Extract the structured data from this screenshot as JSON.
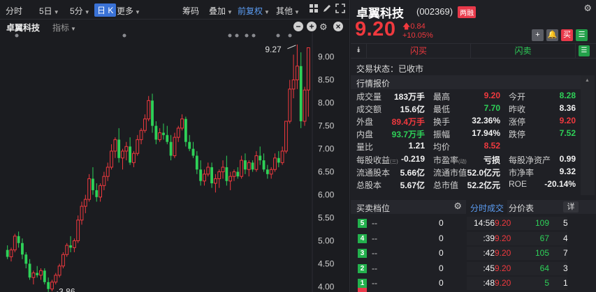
{
  "toolbar": {
    "items": [
      "分时",
      "5日",
      "5分",
      "日 K",
      "更多",
      "筹码",
      "叠加",
      "前复权",
      "其他"
    ]
  },
  "chart_header": {
    "stock_name": "卓翼科技",
    "indicator_label": "指标"
  },
  "chart_data": {
    "type": "candlestick",
    "y_ticks": [
      "9.00",
      "8.50",
      "8.00",
      "7.50",
      "7.00",
      "6.50",
      "6.00",
      "5.50",
      "5.00",
      "4.50",
      "4.00"
    ],
    "ylim": [
      3.9,
      9.45
    ],
    "annotations": {
      "high_label": "9.27",
      "low_label": "3.86"
    },
    "candles": [
      [
        4.8,
        4.9,
        4.6,
        4.65
      ],
      [
        4.65,
        4.85,
        4.55,
        4.8
      ],
      [
        4.8,
        5.15,
        4.75,
        5.1
      ],
      [
        5.1,
        5.2,
        4.85,
        4.95
      ],
      [
        4.95,
        5.05,
        4.6,
        4.7
      ],
      [
        4.7,
        4.75,
        4.4,
        4.5
      ],
      [
        4.5,
        4.6,
        4.15,
        4.2
      ],
      [
        4.2,
        4.35,
        4.05,
        4.3
      ],
      [
        4.3,
        4.45,
        4.2,
        4.25
      ],
      [
        4.25,
        4.4,
        4.15,
        4.35
      ],
      [
        4.35,
        4.4,
        4.05,
        4.1
      ],
      [
        4.1,
        4.2,
        3.86,
        3.95
      ],
      [
        3.95,
        4.15,
        3.9,
        4.1
      ],
      [
        4.1,
        4.3,
        4.05,
        4.25
      ],
      [
        4.25,
        4.5,
        4.2,
        4.45
      ],
      [
        4.45,
        4.75,
        4.4,
        4.7
      ],
      [
        4.7,
        4.95,
        4.65,
        4.9
      ],
      [
        4.9,
        5.1,
        4.75,
        4.85
      ],
      [
        4.85,
        5.05,
        4.75,
        5.0
      ],
      [
        5.0,
        5.55,
        4.95,
        5.45
      ],
      [
        5.45,
        5.85,
        5.35,
        5.75
      ],
      [
        5.75,
        6.0,
        5.6,
        5.9
      ],
      [
        5.9,
        6.45,
        5.85,
        6.35
      ],
      [
        6.35,
        6.6,
        6.0,
        6.1
      ],
      [
        6.1,
        6.25,
        5.85,
        5.95
      ],
      [
        5.95,
        6.25,
        5.85,
        6.2
      ],
      [
        6.2,
        6.5,
        6.1,
        6.4
      ],
      [
        6.4,
        6.7,
        6.3,
        6.6
      ],
      [
        6.6,
        7.1,
        6.55,
        6.95
      ],
      [
        6.95,
        7.25,
        6.8,
        7.2
      ],
      [
        7.2,
        7.45,
        6.7,
        6.8
      ],
      [
        6.8,
        7.0,
        6.55,
        6.95
      ],
      [
        6.95,
        7.15,
        6.75,
        7.05
      ],
      [
        7.05,
        7.25,
        6.65,
        6.7
      ],
      [
        6.7,
        6.95,
        6.6,
        6.9
      ],
      [
        6.9,
        7.3,
        6.85,
        7.2
      ],
      [
        7.2,
        7.45,
        7.1,
        7.4
      ],
      [
        7.4,
        7.75,
        7.35,
        7.65
      ],
      [
        7.65,
        8.15,
        7.6,
        8.05
      ],
      [
        8.05,
        8.2,
        7.35,
        7.5
      ],
      [
        7.5,
        7.6,
        7.1,
        7.2
      ],
      [
        7.2,
        7.45,
        7.15,
        7.35
      ],
      [
        7.35,
        7.55,
        7.2,
        7.3
      ],
      [
        7.3,
        7.5,
        7.1,
        7.15
      ],
      [
        7.15,
        7.3,
        6.75,
        6.85
      ],
      [
        6.85,
        7.35,
        6.8,
        7.25
      ],
      [
        7.25,
        7.5,
        7.15,
        7.45
      ],
      [
        7.45,
        7.75,
        7.4,
        7.65
      ],
      [
        7.65,
        7.7,
        7.05,
        7.15
      ],
      [
        7.15,
        7.3,
        6.95,
        7.0
      ],
      [
        7.0,
        7.15,
        6.8,
        6.85
      ],
      [
        6.85,
        6.95,
        6.45,
        6.55
      ],
      [
        6.55,
        6.75,
        6.2,
        6.3
      ],
      [
        6.3,
        6.55,
        6.2,
        6.45
      ],
      [
        6.45,
        6.7,
        6.4,
        6.6
      ],
      [
        6.6,
        6.7,
        6.15,
        6.25
      ],
      [
        6.25,
        6.45,
        6.05,
        6.35
      ],
      [
        6.35,
        6.55,
        6.15,
        6.5
      ],
      [
        6.5,
        6.75,
        6.35,
        6.6
      ],
      [
        6.6,
        6.85,
        6.2,
        6.3
      ],
      [
        6.3,
        6.5,
        6.1,
        6.4
      ],
      [
        6.4,
        6.55,
        6.3,
        6.5
      ],
      [
        6.5,
        6.6,
        6.35,
        6.4
      ],
      [
        6.4,
        6.85,
        6.35,
        6.75
      ],
      [
        6.75,
        6.9,
        6.45,
        6.55
      ],
      [
        6.55,
        6.75,
        6.4,
        6.7
      ],
      [
        6.7,
        6.75,
        6.5,
        6.55
      ],
      [
        6.55,
        6.95,
        6.5,
        6.85
      ],
      [
        6.85,
        7.05,
        6.65,
        6.75
      ],
      [
        6.75,
        6.9,
        6.5,
        6.55
      ],
      [
        6.55,
        6.65,
        6.35,
        6.45
      ],
      [
        6.45,
        6.6,
        6.35,
        6.55
      ],
      [
        6.55,
        6.9,
        6.5,
        6.8
      ],
      [
        6.8,
        6.95,
        6.6,
        6.7
      ],
      [
        6.7,
        7.05,
        6.65,
        6.95
      ],
      [
        6.95,
        7.5,
        6.9,
        7.6
      ],
      [
        7.6,
        8.5,
        7.55,
        8.3
      ],
      [
        8.3,
        9.05,
        8.1,
        8.5
      ],
      [
        8.5,
        9.27,
        8.3,
        8.8
      ],
      [
        8.8,
        9.1,
        7.45,
        7.6
      ],
      [
        7.6,
        8.35,
        7.5,
        8.28
      ],
      [
        8.28,
        9.2,
        7.7,
        9.2
      ]
    ]
  },
  "quote": {
    "name": "卓翼科技",
    "code": "(002369)",
    "badge": "两融",
    "price": "9.20",
    "change": "0.84",
    "change_pct": "+10.05%",
    "flash_buy": "闪买",
    "flash_sell": "闪卖",
    "status": "交易状态：已收市",
    "section_quote": "行情报价",
    "rows": [
      [
        [
          "成交量",
          "183万手",
          "white"
        ],
        [
          "最高",
          "9.20",
          "red"
        ],
        [
          "今开",
          "8.28",
          "green"
        ]
      ],
      [
        [
          "成交额",
          "15.6亿",
          "white"
        ],
        [
          "最低",
          "7.70",
          "green"
        ],
        [
          "昨收",
          "8.36",
          "white"
        ]
      ],
      [
        [
          "外盘",
          "89.4万手",
          "red"
        ],
        [
          "换手",
          "32.36%",
          "white"
        ],
        [
          "涨停",
          "9.20",
          "red"
        ]
      ],
      [
        [
          "内盘",
          "93.7万手",
          "green"
        ],
        [
          "振幅",
          "17.94%",
          "white"
        ],
        [
          "跌停",
          "7.52",
          "green"
        ]
      ],
      [
        [
          "量比",
          "1.21",
          "white"
        ],
        [
          "均价",
          "8.52",
          "red"
        ],
        [
          "",
          "",
          "white"
        ]
      ]
    ],
    "fundamentals": [
      [
        [
          "每股收益",
          "(三)",
          "-0.219"
        ],
        [
          "市盈率",
          "(动)",
          "亏损"
        ],
        [
          "每股净资产",
          "",
          "0.99"
        ]
      ],
      [
        [
          "流通股本",
          "",
          "5.66亿"
        ],
        [
          "流通市值",
          "",
          "52.0亿元"
        ],
        [
          "市净率",
          "",
          "9.32"
        ]
      ],
      [
        [
          "总股本",
          "",
          "5.67亿"
        ],
        [
          "总市值",
          "",
          "52.2亿元"
        ],
        [
          "ROE",
          "",
          "-20.14%"
        ]
      ]
    ]
  },
  "orderbook": {
    "title": "买卖档位",
    "levels": [
      {
        "num": "5",
        "price": "--",
        "vol": "0"
      },
      {
        "num": "4",
        "price": "--",
        "vol": "0"
      },
      {
        "num": "3",
        "price": "--",
        "vol": "0"
      },
      {
        "num": "2",
        "price": "--",
        "vol": "0"
      },
      {
        "num": "1",
        "price": "--",
        "vol": "0"
      }
    ]
  },
  "ticks": {
    "tab_active": "分时成交",
    "tab_other": "分价表",
    "detail_btn": "详",
    "rows": [
      {
        "time": "14:56",
        "price": "9.20",
        "vol": "109",
        "count": "5"
      },
      {
        "time": ":39",
        "price": "9.20",
        "vol": "67",
        "count": "4"
      },
      {
        "time": ":42",
        "price": "9.20",
        "vol": "105",
        "count": "7"
      },
      {
        "time": ":45",
        "price": "9.20",
        "vol": "64",
        "count": "3"
      },
      {
        "time": ":48",
        "price": "9.20",
        "vol": "5",
        "count": "1"
      }
    ]
  },
  "colors": {
    "up": "#f0393e",
    "down": "#2ed158",
    "accent": "#3a72d6"
  }
}
